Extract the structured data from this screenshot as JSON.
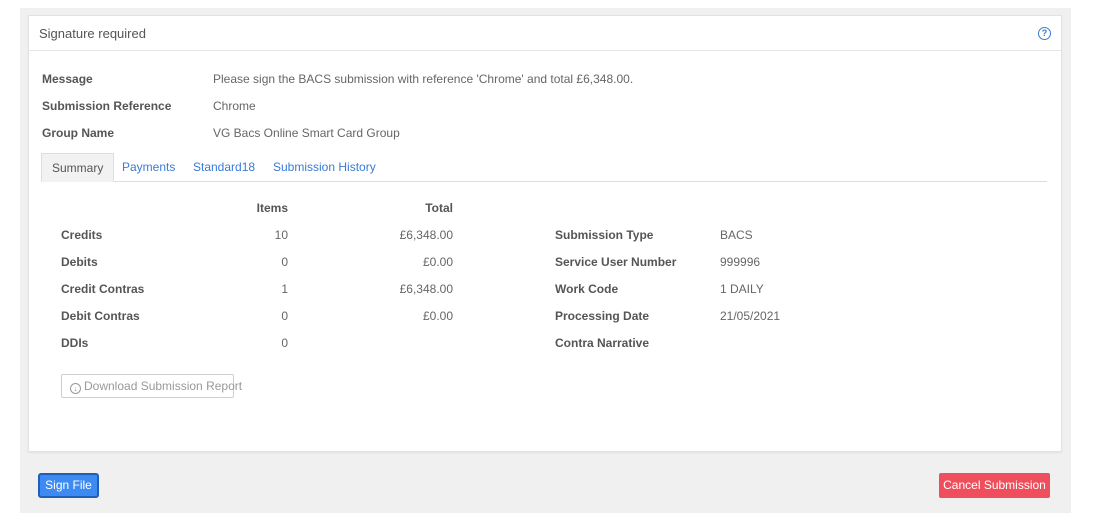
{
  "panel": {
    "title": "Signature required",
    "help_icon": "question-circle-icon"
  },
  "info": [
    {
      "label": "Message",
      "value": "Please sign the BACS submission with reference 'Chrome' and total £6,348.00."
    },
    {
      "label": "Submission Reference",
      "value": "Chrome"
    },
    {
      "label": "Group Name",
      "value": "VG Bacs Online Smart Card Group"
    }
  ],
  "tabs": [
    {
      "label": "Summary",
      "active": true
    },
    {
      "label": "Payments",
      "active": false
    },
    {
      "label": "Standard18",
      "active": false
    },
    {
      "label": "Submission History",
      "active": false
    }
  ],
  "summary": {
    "headers": {
      "items": "Items",
      "total": "Total"
    },
    "rows": [
      {
        "label": "Credits",
        "items": "10",
        "total": "£6,348.00"
      },
      {
        "label": "Debits",
        "items": "0",
        "total": "£0.00"
      },
      {
        "label": "Credit Contras",
        "items": "1",
        "total": "£6,348.00"
      },
      {
        "label": "Debit Contras",
        "items": "0",
        "total": "£0.00"
      },
      {
        "label": "DDIs",
        "items": "0",
        "total": ""
      }
    ],
    "details": [
      {
        "label": "Submission Type",
        "value": "BACS"
      },
      {
        "label": "Service User Number",
        "value": "999996"
      },
      {
        "label": "Work Code",
        "value": "1 DAILY"
      },
      {
        "label": "Processing Date",
        "value": "21/05/2021"
      },
      {
        "label": "Contra Narrative",
        "value": ""
      }
    ],
    "download_label": "Download Submission Report",
    "download_icon": "arrow-down-circle-icon"
  },
  "actions": {
    "sign_label": "Sign File",
    "cancel_label": "Cancel Submission"
  },
  "colors": {
    "link": "#3a7bd5",
    "primary": "#3d8bf2",
    "danger": "#ef4f5c"
  }
}
